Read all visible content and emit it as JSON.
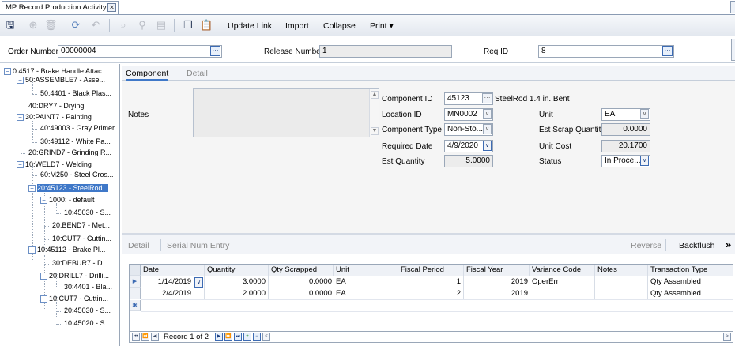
{
  "window": {
    "tab_title": "MP Record Production Activity",
    "close_glyph": "✕"
  },
  "toolbar": {
    "icons": [
      "save-icon",
      "new-icon",
      "delete-icon",
      "refresh-icon",
      "undo-icon",
      "find-icon",
      "binoculars-icon",
      "grid-icon",
      "copy-icon",
      "paste-icon"
    ],
    "update_link": "Update Link",
    "import": "Import",
    "collapse": "Collapse",
    "print": "Print ▾"
  },
  "header": {
    "order_number_label": "Order Number",
    "order_number_value": "00000004",
    "release_number_label": "Release Number",
    "release_number_value": "1",
    "req_id_label": "Req ID",
    "req_id_value": "8",
    "lookup_glyph": "···"
  },
  "tree": {
    "nodes": [
      {
        "label": "0:4517 - Brake Handle Attac...",
        "toggle": "−"
      },
      {
        "label": "50:ASSEMBLE7 - Asse...",
        "toggle": "−"
      },
      {
        "label": "50:4401 - Black Plas...",
        "toggle": ""
      },
      {
        "label": "40:DRY7 - Drying",
        "toggle": ""
      },
      {
        "label": "30:PAINT7 - Painting",
        "toggle": "−"
      },
      {
        "label": "40:49003 - Gray Primer",
        "toggle": ""
      },
      {
        "label": "30:49112 - White Pa...",
        "toggle": ""
      },
      {
        "label": "20:GRIND7 - Grinding R...",
        "toggle": ""
      },
      {
        "label": "10:WELD7 - Welding",
        "toggle": "−"
      },
      {
        "label": "60:M250 - Steel Cros...",
        "toggle": ""
      },
      {
        "label": "20:45123 - SteelRod...",
        "toggle": "−"
      },
      {
        "label": "1000: - default",
        "toggle": "−"
      },
      {
        "label": "10:45030 - S...",
        "toggle": ""
      },
      {
        "label": "20:BEND7 - Met...",
        "toggle": ""
      },
      {
        "label": "10:CUT7 - Cuttin...",
        "toggle": ""
      },
      {
        "label": "10:45112 - Brake Pl...",
        "toggle": "−"
      },
      {
        "label": "30:DEBUR7 - D...",
        "toggle": ""
      },
      {
        "label": "20:DRILL7 - Drilli...",
        "toggle": "−"
      },
      {
        "label": "30:4401 - Bla...",
        "toggle": ""
      },
      {
        "label": "10:CUT7 - Cuttin...",
        "toggle": "−"
      },
      {
        "label": "20:45030 - S...",
        "toggle": ""
      },
      {
        "label": "10:45020 - S...",
        "toggle": ""
      }
    ]
  },
  "main_tabs": {
    "component": "Component",
    "detail": "Detail"
  },
  "component": {
    "notes_label": "Notes",
    "component_id_label": "Component ID",
    "component_id_value": "45123",
    "component_desc": "SteelRod 1.4 in. Bent",
    "location_id_label": "Location ID",
    "location_id_value": "MN0002",
    "component_type_label": "Component Type",
    "component_type_value": "Non-Sto...",
    "required_date_label": "Required Date",
    "required_date_value": "4/9/2020",
    "est_quantity_label": "Est Quantity",
    "est_quantity_value": "5.0000",
    "unit_label": "Unit",
    "unit_value": "EA",
    "est_scrap_label": "Est Scrap Quantity",
    "est_scrap_value": "0.0000",
    "unit_cost_label": "Unit Cost",
    "unit_cost_value": "20.1700",
    "status_label": "Status",
    "status_value": "In Proce..."
  },
  "sub_tabs": {
    "detail": "Detail",
    "serial": "Serial Num Entry",
    "reverse": "Reverse",
    "backflush": "Backflush",
    "more": "»"
  },
  "grid": {
    "columns": [
      "Date",
      "Quantity",
      "Qty Scrapped",
      "Unit",
      "Fiscal Period",
      "Fiscal Year",
      "Variance Code",
      "Notes",
      "Transaction Type"
    ],
    "rows": [
      [
        "1/14/2019",
        "3.0000",
        "0.0000",
        "EA",
        "1",
        "2019",
        "OperErr",
        "",
        "Qty Assembled"
      ],
      [
        "2/4/2019",
        "2.0000",
        "0.0000",
        "EA",
        "2",
        "2019",
        "",
        "",
        "Qty Assembled"
      ]
    ],
    "record_text": "Record 1 of 2"
  }
}
